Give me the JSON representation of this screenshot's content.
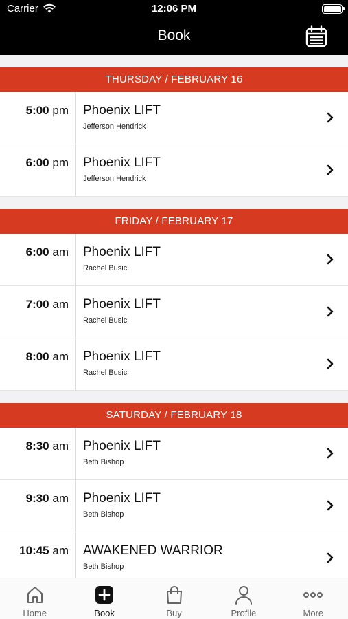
{
  "status_bar": {
    "carrier": "Carrier",
    "time": "12:06 PM"
  },
  "nav": {
    "title": "Book"
  },
  "sections": [
    {
      "header": "THURSDAY / FEBRUARY 16",
      "rows": [
        {
          "time": "5:00",
          "ampm": "pm",
          "class_name": "Phoenix LIFT",
          "instructor": "Jefferson Hendrick"
        },
        {
          "time": "6:00",
          "ampm": "pm",
          "class_name": "Phoenix LIFT",
          "instructor": "Jefferson Hendrick"
        }
      ]
    },
    {
      "header": "FRIDAY / FEBRUARY 17",
      "rows": [
        {
          "time": "6:00",
          "ampm": "am",
          "class_name": "Phoenix LIFT",
          "instructor": "Rachel Busic"
        },
        {
          "time": "7:00",
          "ampm": "am",
          "class_name": "Phoenix LIFT",
          "instructor": "Rachel Busic"
        },
        {
          "time": "8:00",
          "ampm": "am",
          "class_name": "Phoenix LIFT",
          "instructor": "Rachel Busic"
        }
      ]
    },
    {
      "header": "SATURDAY / FEBRUARY 18",
      "rows": [
        {
          "time": "8:30",
          "ampm": "am",
          "class_name": "Phoenix LIFT",
          "instructor": "Beth Bishop"
        },
        {
          "time": "9:30",
          "ampm": "am",
          "class_name": "Phoenix LIFT",
          "instructor": "Beth Bishop"
        },
        {
          "time": "10:45",
          "ampm": "am",
          "class_name": "AWAKENED WARRIOR",
          "instructor": "Beth Bishop"
        }
      ]
    }
  ],
  "tab_bar": {
    "home": "Home",
    "book": "Book",
    "buy": "Buy",
    "profile": "Profile",
    "more": "More"
  },
  "colors": {
    "accent": "#d63b22",
    "bar": "#000000"
  }
}
